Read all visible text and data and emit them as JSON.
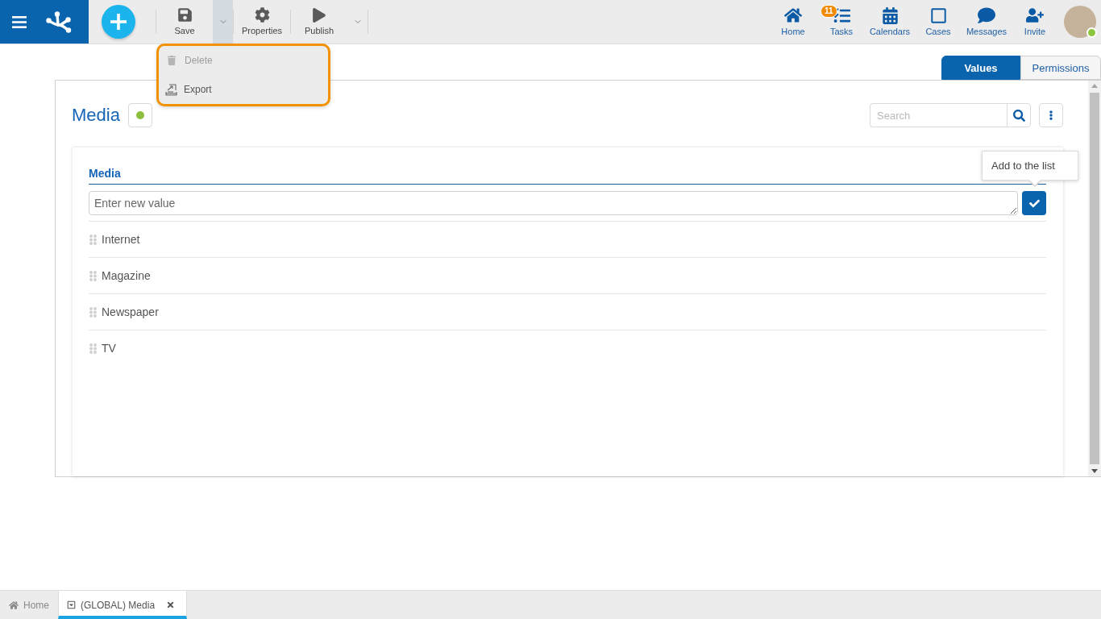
{
  "toolbar": {
    "actions": [
      {
        "kind": "button",
        "label": "Save"
      },
      {
        "kind": "caret",
        "expanded": true
      },
      {
        "kind": "button",
        "label": "Properties"
      },
      {
        "kind": "button",
        "label": "Publish"
      },
      {
        "kind": "caret",
        "expanded": false
      }
    ]
  },
  "dropdown_menu": {
    "highlighted": true,
    "items": [
      {
        "label": "Delete",
        "disabled": true
      },
      {
        "label": "Export",
        "disabled": false
      }
    ]
  },
  "nav": [
    {
      "label": "Home"
    },
    {
      "label": "Tasks",
      "badge": "11"
    },
    {
      "label": "Calendars"
    },
    {
      "label": "Cases"
    },
    {
      "label": "Messages"
    },
    {
      "label": "Invite"
    }
  ],
  "user": {
    "online": true
  },
  "view_tabs": [
    {
      "label": "Values",
      "selected": true
    },
    {
      "label": "Permissions",
      "selected": false
    }
  ],
  "panel": {
    "title": "Media",
    "status_on": true,
    "search": {
      "placeholder": "Search"
    },
    "list": {
      "column": "Media",
      "input": {
        "placeholder": "Enter new value"
      },
      "tooltip": "Add to the list",
      "items": [
        {
          "label": "Internet"
        },
        {
          "label": "Magazine"
        },
        {
          "label": "Newspaper"
        },
        {
          "label": "TV"
        }
      ]
    }
  },
  "bottom_tabs": [
    {
      "kind": "home",
      "label": "Home",
      "selected": false,
      "closable": false
    },
    {
      "kind": "document",
      "label": "(GLOBAL) Media",
      "selected": true,
      "closable": true
    }
  ]
}
